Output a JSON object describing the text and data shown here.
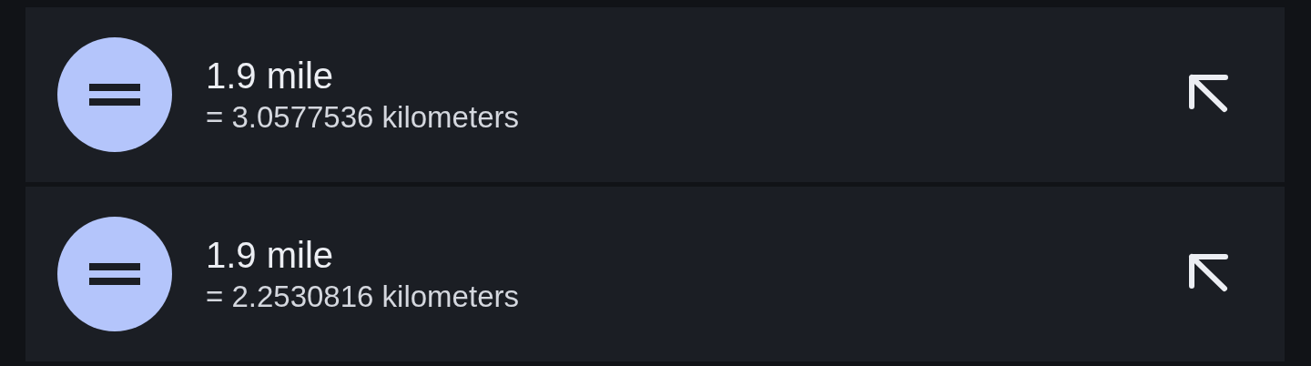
{
  "results": [
    {
      "title": "1.9 mile",
      "result": "= 3.0577536 kilometers"
    },
    {
      "title": "1.9 mile",
      "result": "= 2.2530816 kilometers"
    }
  ]
}
